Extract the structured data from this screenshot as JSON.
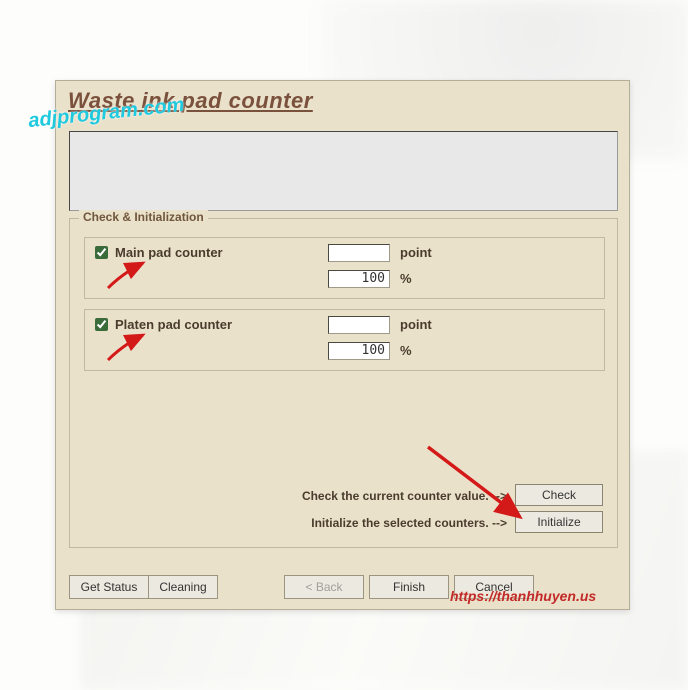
{
  "title": "Waste ink pad counter",
  "group_label": "Check & Initialization",
  "counters": {
    "main": {
      "label": "Main pad counter",
      "checked": true,
      "point_value": "",
      "percent_value": "100"
    },
    "platen": {
      "label": "Platen pad counter",
      "checked": true,
      "point_value": "",
      "percent_value": "100"
    }
  },
  "units": {
    "point": "point",
    "percent": "%"
  },
  "hints": {
    "check": "Check the current counter value. -->",
    "init": "Initialize the selected counters. -->"
  },
  "buttons": {
    "check": "Check",
    "initialize": "Initialize",
    "get_status": "Get Status",
    "cleaning": "Cleaning",
    "back": "< Back",
    "finish": "Finish",
    "cancel": "Cancel"
  },
  "watermarks": {
    "top": "adjprogram.com",
    "bottom": "https://thanhhuyen.us"
  }
}
